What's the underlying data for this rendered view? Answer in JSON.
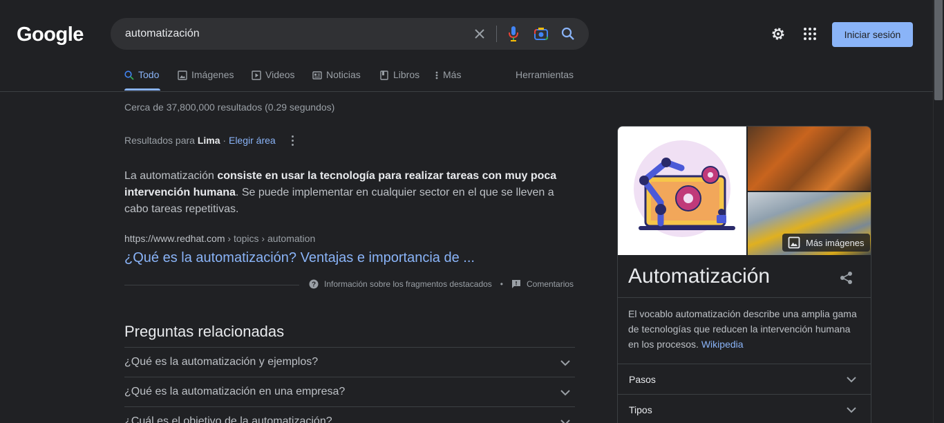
{
  "header": {
    "logo": "Google",
    "search_value": "automatización",
    "signin_label": "Iniciar sesión"
  },
  "tabs": [
    {
      "label": "Todo",
      "icon": "search-icon"
    },
    {
      "label": "Imágenes",
      "icon": "image-icon"
    },
    {
      "label": "Videos",
      "icon": "video-icon"
    },
    {
      "label": "Noticias",
      "icon": "news-icon"
    },
    {
      "label": "Libros",
      "icon": "book-icon"
    },
    {
      "label": "Más",
      "icon": "more-vert-icon"
    }
  ],
  "tools_label": "Herramientas",
  "stats": "Cerca de 37,800,000 resultados (0.29 segundos)",
  "results_for": {
    "prefix": "Resultados para",
    "location": "Lima",
    "separator": "·",
    "change_area": "Elegir área"
  },
  "snippet": {
    "part1": "La automatización ",
    "bold1": "consiste en usar la tecnología para realizar tareas con muy poca intervención humana",
    "part2": ". Se puede implementar en cualquier sector en el que se lleven a cabo tareas repetitivas.",
    "cite_domain": "https://www.redhat.com",
    "cite_path": " › topics › automation",
    "title": "¿Qué es la automatización? Ventajas e importancia de ..."
  },
  "feedback": {
    "about_label": "Información sobre los fragmentos destacados",
    "bullet": "•",
    "comments_label": "Comentarios"
  },
  "related_questions": {
    "title": "Preguntas relacionadas",
    "items": [
      "¿Qué es la automatización y ejemplos?",
      "¿Qué es la automatización en una empresa?",
      "¿Cuál es el objetivo de la automatización?"
    ]
  },
  "knowledge_panel": {
    "more_images": "Más imágenes",
    "title": "Automatización",
    "description": "El vocablo automatización describe una amplia gama de tecnologías que reducen la intervención humana en los procesos. ",
    "source": "Wikipedia",
    "rows": [
      "Pasos",
      "Tipos"
    ]
  },
  "colors": {
    "background": "#202124",
    "link": "#8ab4f8",
    "text": "#bdc1c6",
    "accent_button": "#8ab4f8"
  }
}
